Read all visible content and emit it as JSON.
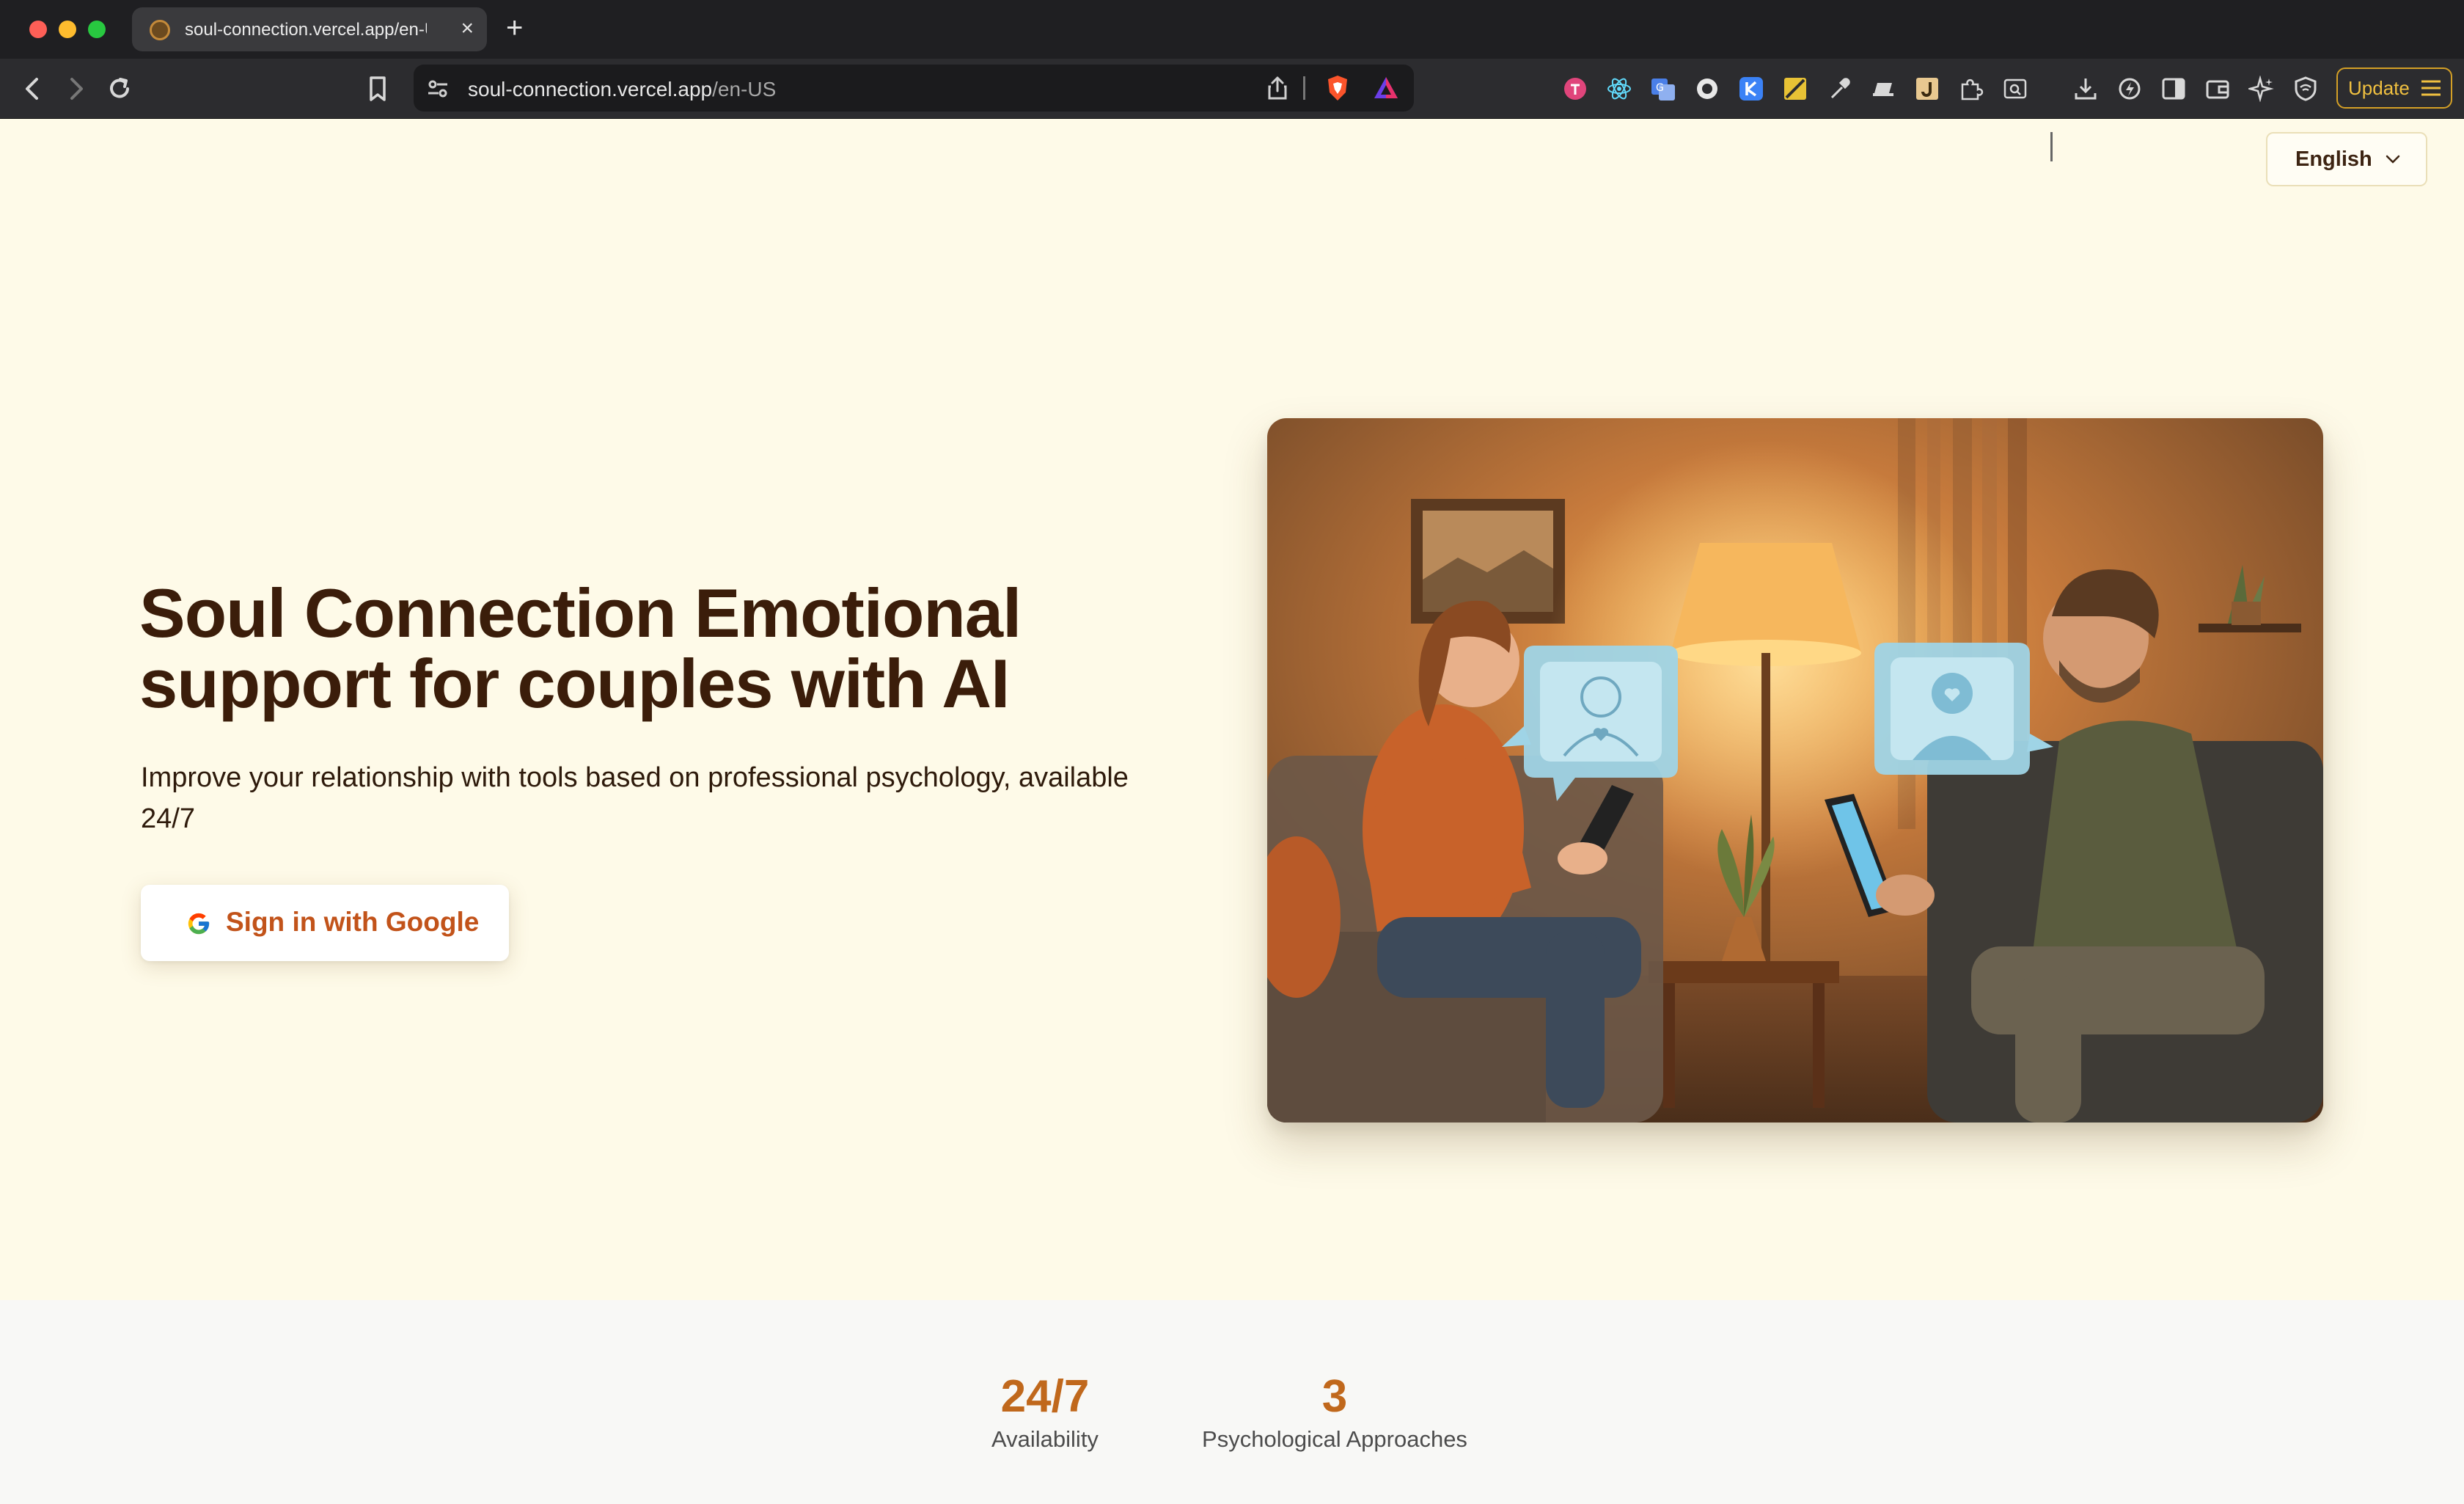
{
  "browser": {
    "tab": {
      "title": "soul-connection.vercel.app/en-US",
      "close": "×"
    },
    "new_tab": "+",
    "url": {
      "domain": "soul-connection.vercel.app",
      "path": "/en-US"
    },
    "update_label": "Update",
    "icons": [
      "back-icon",
      "forward-icon",
      "reload-icon",
      "bookmark-icon",
      "site-settings-icon",
      "share-icon",
      "brave-shields-icon",
      "brave-rewards-icon",
      "download-icon",
      "sidebar-icon",
      "wallet-icon",
      "leo-ai-icon",
      "vpn-icon",
      "menu-icon"
    ],
    "extensions": [
      {
        "name": "ext-pink-icon",
        "color": "#e0457b"
      },
      {
        "name": "ext-react-icon",
        "color": "#61dafb"
      },
      {
        "name": "ext-translate-icon",
        "color": "#4a7fe8"
      },
      {
        "name": "ext-circle-icon",
        "color": "#e8e8e8"
      },
      {
        "name": "ext-k-icon",
        "color": "#3b82f6"
      },
      {
        "name": "ext-yellow-icon",
        "color": "#e8c235"
      },
      {
        "name": "ext-eyedropper-icon",
        "color": "#d8d8d8"
      },
      {
        "name": "ext-screen-icon",
        "color": "#d8d8d8"
      },
      {
        "name": "ext-j-icon",
        "color": "#e8c890"
      },
      {
        "name": "ext-puzzle-icon",
        "color": "#d8d8d8"
      },
      {
        "name": "ext-search-icon",
        "color": "#d8d8d8"
      }
    ]
  },
  "header": {
    "language": "English"
  },
  "hero": {
    "title": "Soul Connection Emotional support for couples with AI",
    "subtitle": "Improve your relationship with tools based on professional psychology, available 24/7",
    "cta_label": "Sign in with Google"
  },
  "stats": [
    {
      "value": "24/7",
      "label": "Availability"
    },
    {
      "value": "3",
      "label": "Psychological Approaches"
    }
  ],
  "colors": {
    "page_bg": "#fefae8",
    "title": "#3b1d0a",
    "accent": "#c0681c",
    "cta_text": "#c2531a"
  }
}
